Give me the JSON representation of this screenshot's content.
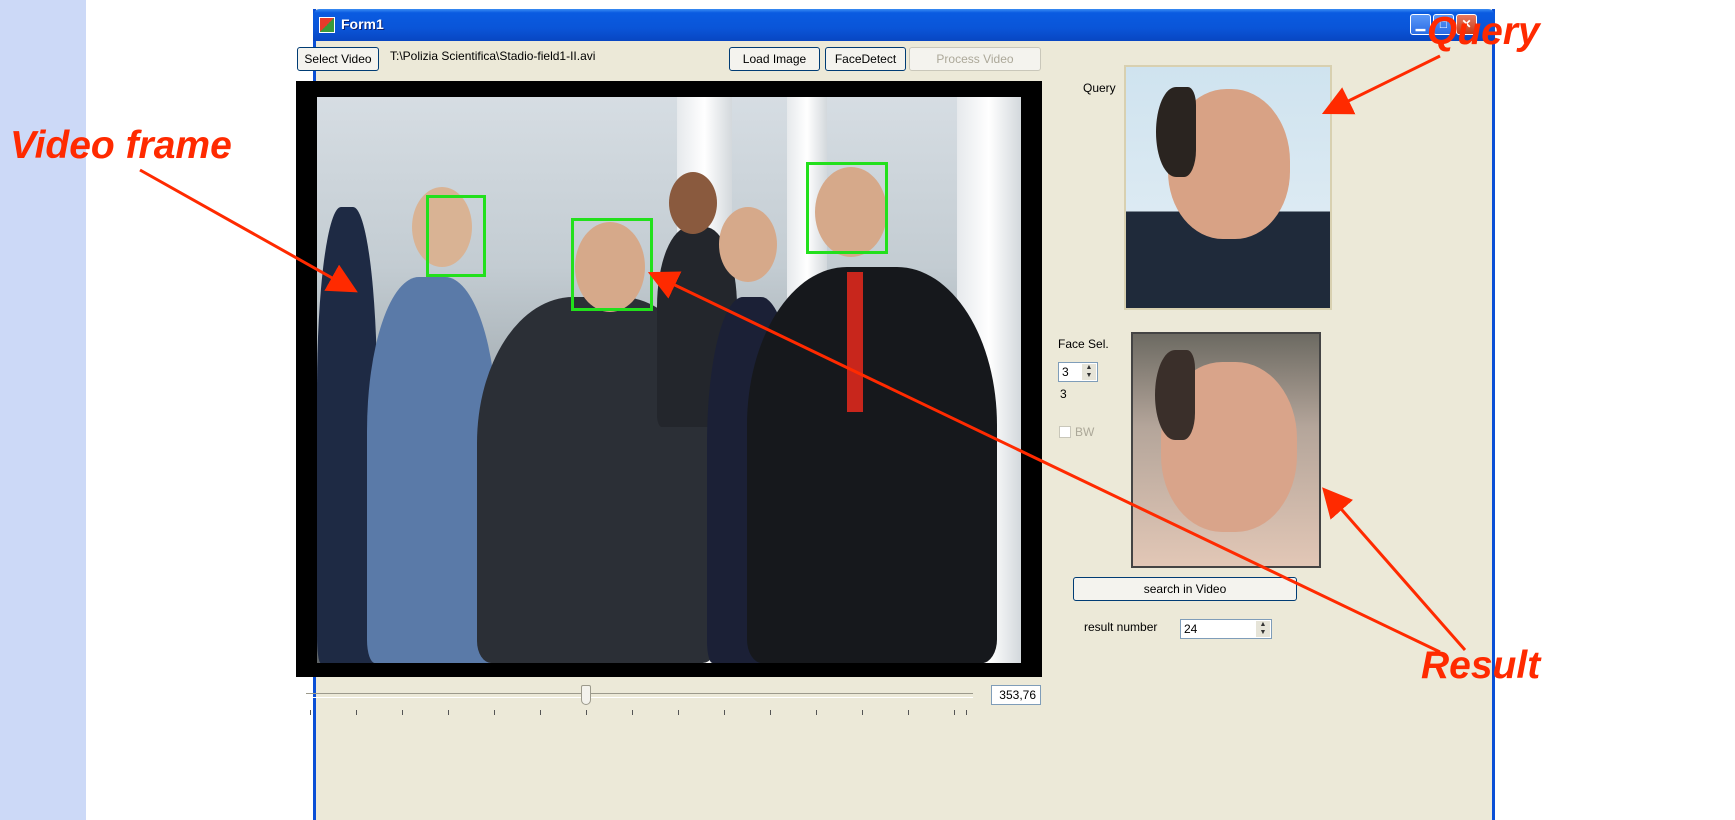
{
  "window": {
    "title": "Form1",
    "title_buttons": [
      "minimize-icon",
      "maximize-icon",
      "close-icon"
    ]
  },
  "toolbar": {
    "select_video_label": "Select Video",
    "video_path": "T:\\Polizia Scientifica\\Stadio-field1-II.avi",
    "load_image_label": "Load Image",
    "face_detect_label": "FaceDetect",
    "process_video_label": "Process Video"
  },
  "query": {
    "label": "Query"
  },
  "face_select": {
    "label": "Face Sel.",
    "spinner_value": "3",
    "value_text": "3",
    "bw_label": "BW",
    "bw_checked": false
  },
  "search": {
    "button_label": "search in Video",
    "result_label": "result  number",
    "result_value": "24"
  },
  "timeline": {
    "value": "353,76"
  },
  "annotations": {
    "video_frame": "Video frame",
    "query": "Query",
    "result": "Result"
  },
  "colors": {
    "annotation": "#ff2a00",
    "face_box": "#22e01c",
    "titlebar": "#0a55d8",
    "window_bg": "#ece9d8"
  }
}
